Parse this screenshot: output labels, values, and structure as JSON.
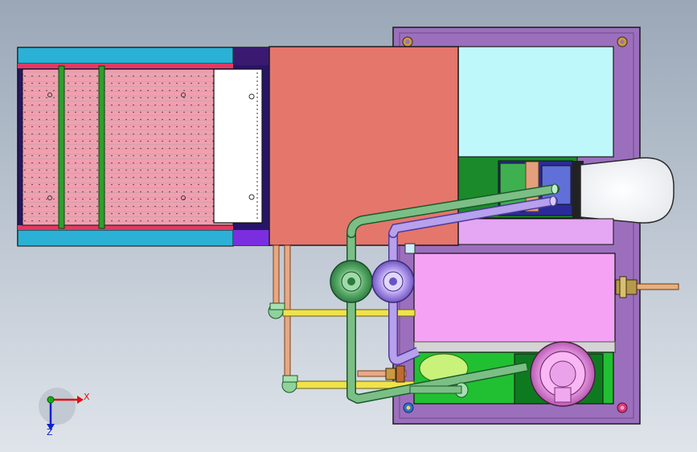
{
  "viewport": {
    "background_top": "#9aa7b7",
    "background_bottom": "#dfe4ea"
  },
  "triad": {
    "x_label": "X",
    "z_label": "Z",
    "x_color": "#e01010",
    "y_color": "#10b010",
    "z_color": "#1020d0"
  },
  "colors": {
    "frame_purple": "#9c6fbd",
    "tank_pink": "#f0a0b0",
    "salmon_hood": "#e5766c",
    "cyan_panel": "#bff8fb",
    "magenta_tank": "#f5a2f5",
    "pipe_green": "#7cbf86",
    "pipe_violet": "#b7a0ec",
    "pipe_yellow": "#f0e24a",
    "pipe_copper": "#e9a882",
    "dark_green": "#1a8a2a",
    "cyan_strip": "#2bb1d6"
  }
}
